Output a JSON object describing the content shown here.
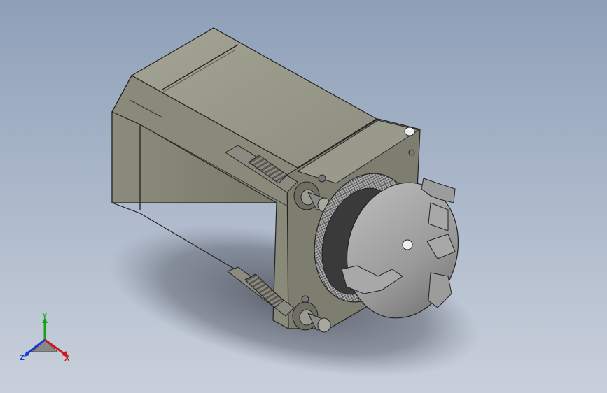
{
  "viewport": {
    "background_top": "#8e9fb8",
    "background_bottom": "#c9d0db"
  },
  "model": {
    "description_icon": "stepper-motor-with-three-jaw-chuck",
    "body_color": "#8a8a7c",
    "chuck_color": "#a0a0a0"
  },
  "triad": {
    "x_label": "X",
    "y_label": "Y",
    "z_label": "Z",
    "x_color": "#d01818",
    "y_color": "#18a018",
    "z_color": "#1838d0"
  }
}
